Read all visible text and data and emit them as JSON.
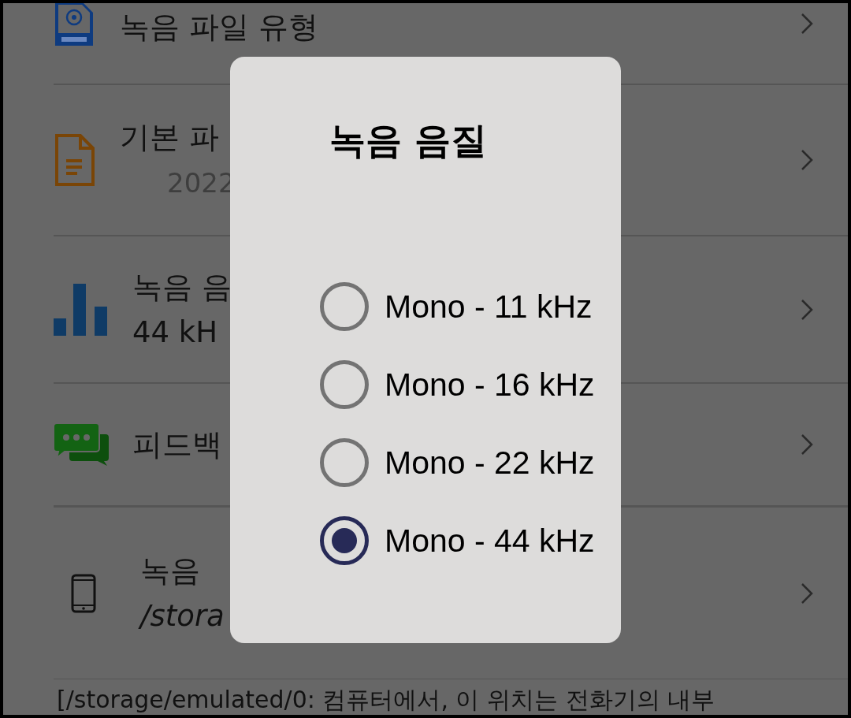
{
  "settings": [
    {
      "kind": "mp3",
      "title": "녹음 파일 유형"
    },
    {
      "kind": "document",
      "title": "기본 파",
      "subtitle": "2022"
    },
    {
      "kind": "bars",
      "title": "녹음 음",
      "subtitle": "44 kH"
    },
    {
      "kind": "chat",
      "title": "피드백"
    },
    {
      "kind": "phone",
      "title": "녹음",
      "subtitle": "/stora"
    }
  ],
  "note": "[/storage/emulated/0: 컴퓨터에서, 이 위치는 전화기의 내부",
  "dialog": {
    "title": "녹음 음질",
    "options": [
      {
        "label": "Mono - 11 kHz",
        "selected": false
      },
      {
        "label": "Mono - 16 kHz",
        "selected": false
      },
      {
        "label": "Mono - 22 kHz",
        "selected": false
      },
      {
        "label": "Mono - 44 kHz",
        "selected": true
      }
    ]
  }
}
